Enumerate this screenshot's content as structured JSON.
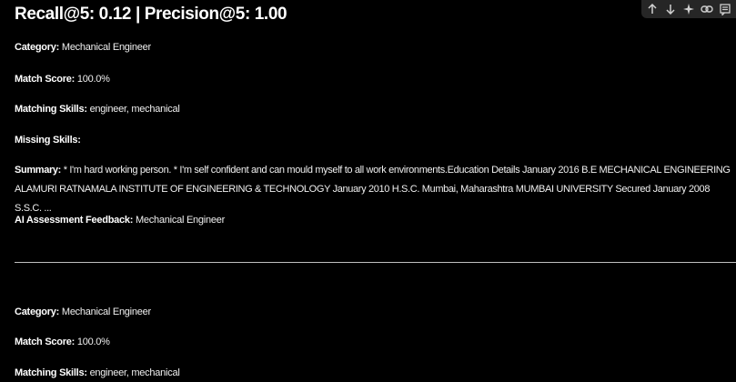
{
  "header": {
    "title": "Recall@5: 0.12 | Precision@5: 1.00"
  },
  "toolbar": {
    "icons": [
      "arrow-up-icon",
      "arrow-down-icon",
      "sparkle-icon",
      "link-icon",
      "notes-icon"
    ]
  },
  "results": [
    {
      "category_label": "Category:",
      "category": "Mechanical Engineer",
      "match_score_label": "Match Score:",
      "match_score": "100.0%",
      "matching_skills_label": "Matching Skills:",
      "matching_skills": "engineer, mechanical",
      "missing_skills_label": "Missing Skills:",
      "summary_label": "Summary:",
      "summary": "* I'm hard working person. * I'm self confident and can mould myself to all work environments.Education Details January 2016 B.E MECHANICAL ENGINEERING ALAMURI RATNAMALA INSTITUTE OF ENGINEERING & TECHNOLOGY January 2010 H.S.C. Mumbai, Maharashtra MUMBAI UNIVERSITY Secured January 2008 S.S.C. ...",
      "feedback_label": "AI Assessment Feedback:",
      "feedback": "Mechanical Engineer"
    },
    {
      "category_label": "Category:",
      "category": "Mechanical Engineer",
      "match_score_label": "Match Score:",
      "match_score": "100.0%",
      "matching_skills_label": "Matching Skills:",
      "matching_skills": "engineer, mechanical"
    }
  ]
}
